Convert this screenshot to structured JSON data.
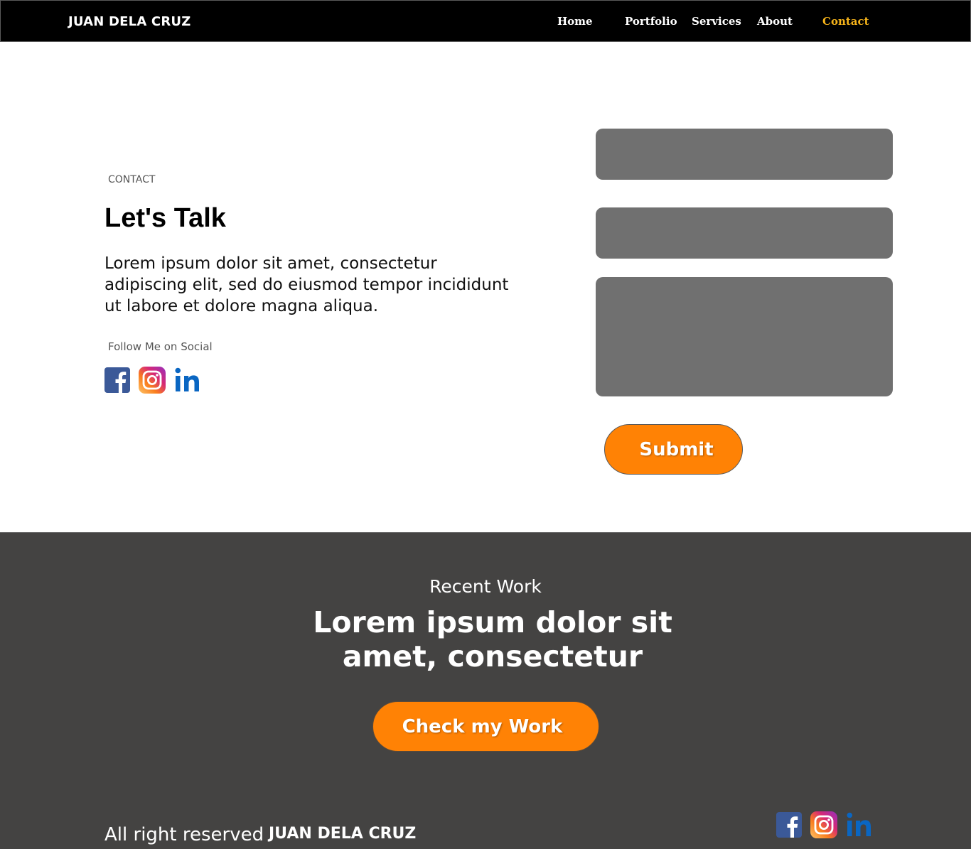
{
  "header": {
    "brand": "JUAN DELA CRUZ",
    "nav": [
      {
        "label": "Home",
        "active": false
      },
      {
        "label": "Portfolio",
        "active": false
      },
      {
        "label": "Services",
        "active": false
      },
      {
        "label": "About",
        "active": false
      },
      {
        "label": "Contact",
        "active": true
      }
    ]
  },
  "contact": {
    "eyebrow": "CONTACT",
    "headline": "Let's Talk",
    "body": "Lorem ipsum dolor sit amet, consectetur adipiscing elit, sed do eiusmod tempor incididunt ut labore et dolore magna aliqua.",
    "follow_label": "Follow Me on Social",
    "social_icons": [
      "facebook-icon",
      "instagram-icon",
      "linkedin-icon"
    ],
    "form": {
      "name_value": "",
      "email_value": "",
      "message_value": "",
      "submit_label": "Submit"
    }
  },
  "footer": {
    "recent_label": "Recent Work",
    "headline": "Lorem ipsum dolor sit amet, consectetur",
    "cta_label": "Check my Work",
    "copyright": "All right reserved",
    "brand": "JUAN DELA CRUZ",
    "social_icons": [
      "facebook-icon",
      "instagram-icon",
      "linkedin-icon"
    ]
  },
  "colors": {
    "header_bg": "#000000",
    "nav_active": "#f5b31a",
    "accent": "#ff8205",
    "field_bg": "#707070",
    "footer_bg": "#444342",
    "facebook": "#3b5998",
    "linkedin": "#0a66c2"
  }
}
